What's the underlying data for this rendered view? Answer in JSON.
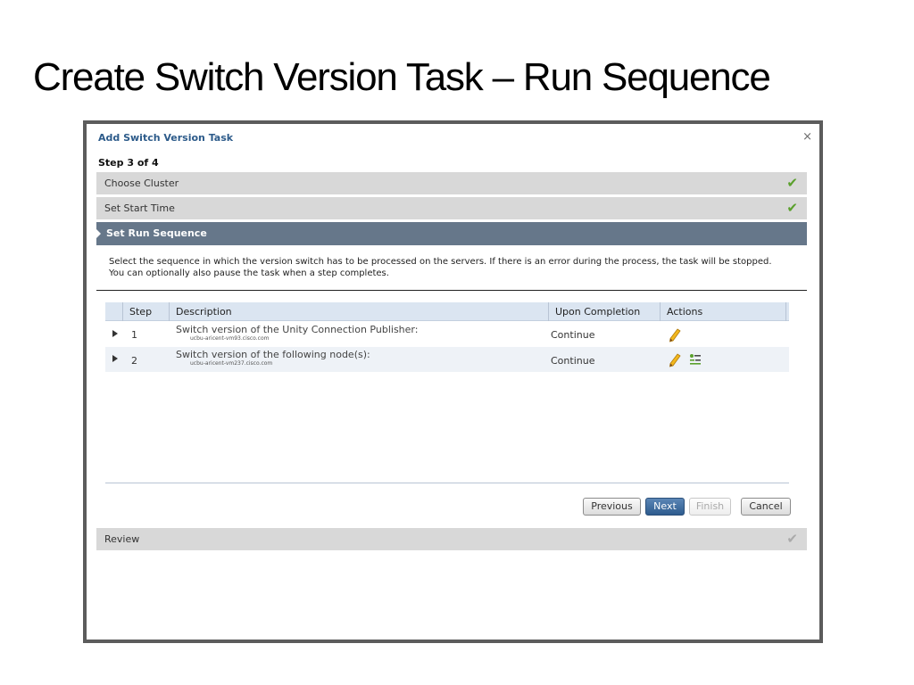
{
  "slide": {
    "title": "Create Switch Version Task – Run Sequence"
  },
  "dialog": {
    "title": "Add Switch Version Task",
    "close_glyph": "×",
    "step": "Step 3 of 4",
    "sections": {
      "choose_cluster": "Choose Cluster",
      "set_start_time": "Set Start Time",
      "set_run_sequence": "Set Run Sequence",
      "review": "Review"
    },
    "instructions": "Select the sequence in which the version switch has to be processed on the servers. If there is an error during the process, the task will be stopped. You can optionally also pause the task when a step completes.",
    "table": {
      "headers": {
        "step": "Step",
        "description": "Description",
        "upon_completion": "Upon Completion",
        "actions": "Actions"
      },
      "rows": [
        {
          "step": "1",
          "description": "Switch version of the Unity Connection Publisher:",
          "host": "ucbu-aricent-vm93.cisco.com",
          "upon_completion": "Continue"
        },
        {
          "step": "2",
          "description": "Switch version of the following node(s):",
          "host": "ucbu-aricent-vm237.cisco.com",
          "upon_completion": "Continue"
        }
      ]
    },
    "buttons": {
      "previous": "Previous",
      "next": "Next",
      "finish": "Finish",
      "cancel": "Cancel"
    }
  },
  "icons": {
    "completed": "check-icon",
    "edit": "pencil-icon",
    "node_list": "node-list-icon"
  },
  "colors": {
    "accent": "#2d5b8a",
    "active_section": "#66778a",
    "section_bg": "#d8d8d8",
    "check": "#5aa02c",
    "primary_button": "#2d5b8e"
  }
}
